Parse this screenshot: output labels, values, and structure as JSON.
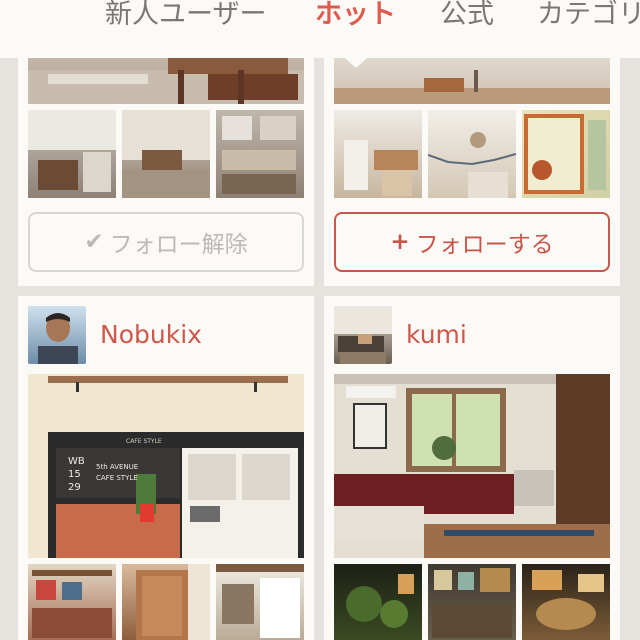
{
  "tabs": [
    {
      "label": "新人ユーザー",
      "active": false
    },
    {
      "label": "ホット",
      "active": true
    },
    {
      "label": "公式",
      "active": false
    },
    {
      "label": "カテゴリ",
      "active": false
    }
  ],
  "accent_color": "#e05a4e",
  "top_cards": {
    "left": {
      "button_icon": "✔",
      "button_label": "フォロー解除",
      "button_state": "following"
    },
    "right": {
      "button_icon": "+",
      "button_label": "フォローする",
      "button_state": "not-following"
    }
  },
  "users": [
    {
      "name": "Nobukix",
      "poster_text": [
        "CAFE STYLE",
        "WB",
        "15",
        "29",
        "5th AVENUE",
        "CAFE STYLE"
      ]
    },
    {
      "name": "kumi"
    }
  ]
}
